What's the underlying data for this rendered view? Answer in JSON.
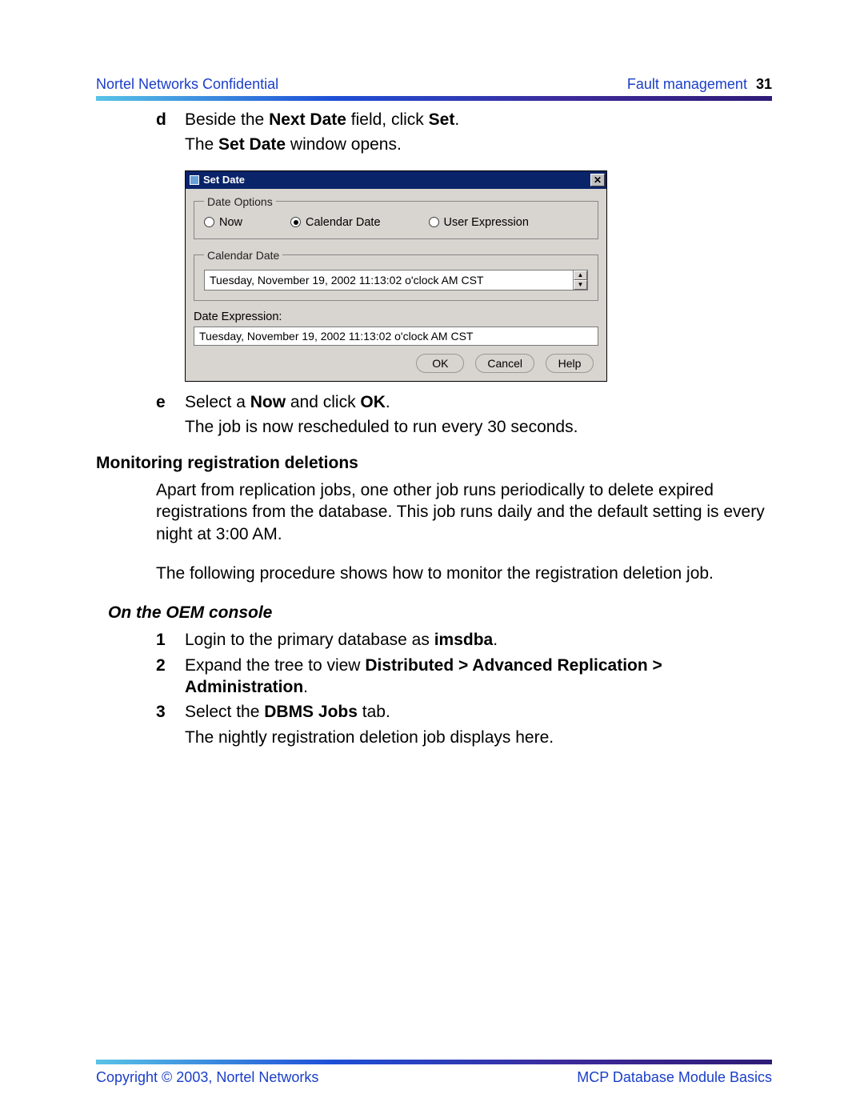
{
  "header": {
    "left": "Nortel Networks Confidential",
    "right": "Fault management",
    "pagenum": "31"
  },
  "step_d": {
    "letter": "d",
    "line1_pre": "Beside the ",
    "line1_b1": "Next Date",
    "line1_mid": " field, click ",
    "line1_b2": "Set",
    "line1_post": ".",
    "line2_pre": "The ",
    "line2_b": "Set Date",
    "line2_post": " window opens."
  },
  "dialog": {
    "title": "Set Date",
    "group_options": "Date Options",
    "radio_now": "Now",
    "radio_cal": "Calendar Date",
    "radio_user": "User Expression",
    "group_cal": "Calendar Date",
    "cal_value": "Tuesday, November 19, 2002 11:13:02 o'clock AM CST",
    "expr_label": "Date Expression:",
    "expr_value": "Tuesday, November 19, 2002 11:13:02 o'clock AM CST",
    "btn_ok": "OK",
    "btn_cancel": "Cancel",
    "btn_help": "Help",
    "close_x": "✕"
  },
  "step_e": {
    "letter": "e",
    "line1_pre": "Select a ",
    "line1_b1": "Now",
    "line1_mid": " and click ",
    "line1_b2": "OK",
    "line1_post": ".",
    "line2": "The job is now rescheduled to run every 30 seconds."
  },
  "section1": {
    "heading": "Monitoring registration deletions",
    "p1": "Apart from replication jobs, one other job runs periodically to delete expired registrations from the database. This job runs daily and the default setting is every night at 3:00 AM.",
    "p2": "The following procedure shows how to monitor the registration deletion job."
  },
  "subheading": "On the OEM console",
  "step1": {
    "num": "1",
    "pre": "Login to the primary database as ",
    "b": "imsdba",
    "post": "."
  },
  "step2": {
    "num": "2",
    "pre": "Expand the tree to view ",
    "b": "Distributed > Advanced Replication > Administration",
    "post": "."
  },
  "step3": {
    "num": "3",
    "pre": "Select the ",
    "b": "DBMS Jobs",
    "post": " tab.",
    "after": "The nightly registration deletion job displays here."
  },
  "footer": {
    "left": "Copyright © 2003, Nortel Networks",
    "right": "MCP Database Module Basics"
  }
}
